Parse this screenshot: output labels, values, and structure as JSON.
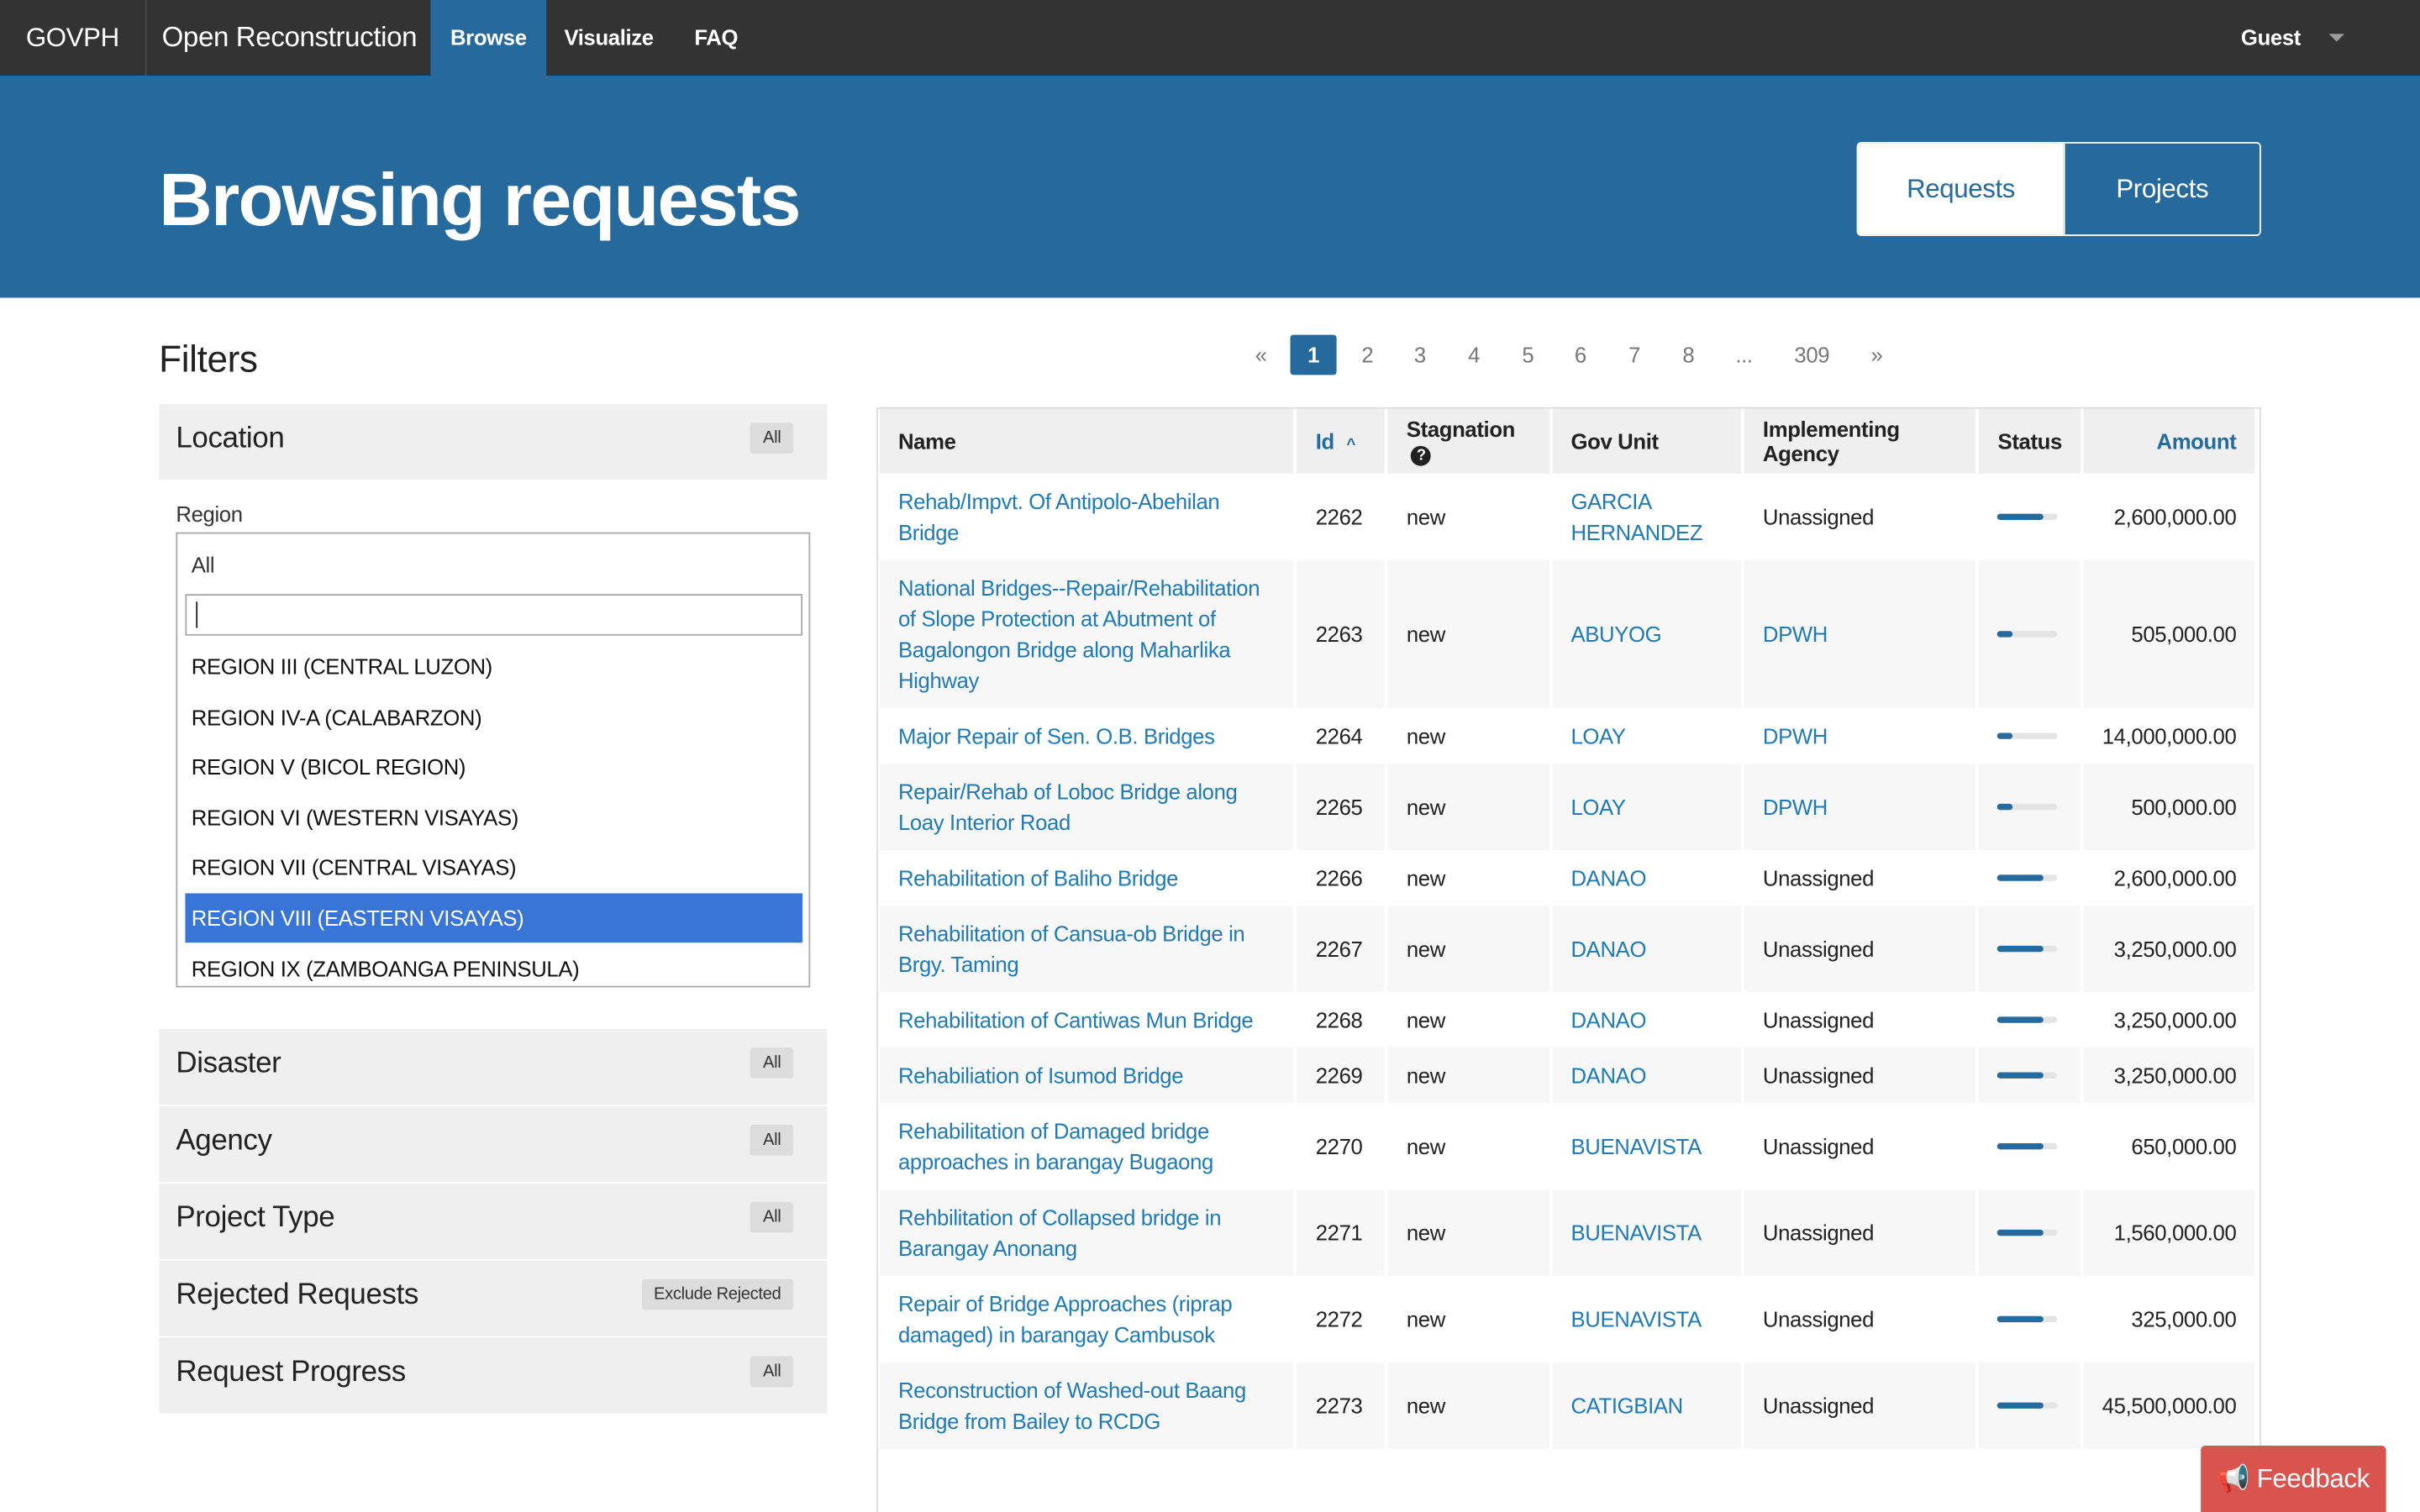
{
  "nav": {
    "brand": "GOVPH",
    "app_name": "Open Reconstruction",
    "links": [
      {
        "label": "Browse"
      },
      {
        "label": "Visualize"
      },
      {
        "label": "FAQ"
      }
    ],
    "user": "Guest"
  },
  "hero": {
    "title": "Browsing requests",
    "toggle": {
      "requests": "Requests",
      "projects": "Projects"
    }
  },
  "filters": {
    "title": "Filters",
    "location": {
      "label": "Location",
      "badge": "All"
    },
    "region": {
      "label": "Region",
      "selected": "All",
      "search_value": "",
      "options": [
        "REGION III (CENTRAL LUZON)",
        "REGION IV-A (CALABARZON)",
        "REGION V (BICOL REGION)",
        "REGION VI (WESTERN VISAYAS)",
        "REGION VII (CENTRAL VISAYAS)",
        "REGION VIII (EASTERN VISAYAS)",
        "REGION IX (ZAMBOANGA PENINSULA)"
      ],
      "highlighted": "REGION VIII (EASTERN VISAYAS)"
    },
    "panels": [
      {
        "label": "Disaster",
        "badge": "All"
      },
      {
        "label": "Agency",
        "badge": "All"
      },
      {
        "label": "Project Type",
        "badge": "All"
      },
      {
        "label": "Rejected Requests",
        "badge": "Exclude Rejected"
      },
      {
        "label": "Request Progress",
        "badge": "All"
      }
    ]
  },
  "pagination": {
    "prev": "«",
    "pages": [
      "1",
      "2",
      "3",
      "4",
      "5",
      "6",
      "7",
      "8",
      "...",
      "309"
    ],
    "current": "1",
    "next": "»"
  },
  "table": {
    "headers": {
      "name": "Name",
      "id": "Id",
      "stagnation": "Stagnation",
      "gov_unit": "Gov Unit",
      "agency": "Implementing Agency",
      "status": "Status",
      "amount": "Amount"
    },
    "rows": [
      {
        "name": "Rehab/Impvt. Of Antipolo-Abehilan Bridge",
        "id": "2262",
        "stagnation": "new",
        "gov_unit": "GARCIA HERNANDEZ",
        "agency": "Unassigned",
        "progress": 0.75,
        "amount": "2,600,000.00"
      },
      {
        "name": "National Bridges--Repair/Rehabilitation of Slope Protection at Abutment of Bagalongon Bridge along Maharlika Highway",
        "id": "2263",
        "stagnation": "new",
        "gov_unit": "ABUYOG",
        "agency": "DPWH",
        "progress": 0.25,
        "amount": "505,000.00"
      },
      {
        "name": "Major Repair of Sen. O.B. Bridges",
        "id": "2264",
        "stagnation": "new",
        "gov_unit": "LOAY",
        "agency": "DPWH",
        "progress": 0.25,
        "amount": "14,000,000.00"
      },
      {
        "name": "Repair/Rehab of Loboc Bridge along Loay Interior Road",
        "id": "2265",
        "stagnation": "new",
        "gov_unit": "LOAY",
        "agency": "DPWH",
        "progress": 0.25,
        "amount": "500,000.00"
      },
      {
        "name": "Rehabilitation of Baliho Bridge",
        "id": "2266",
        "stagnation": "new",
        "gov_unit": "DANAO",
        "agency": "Unassigned",
        "progress": 0.75,
        "amount": "2,600,000.00"
      },
      {
        "name": "Rehabilitation of Cansua-ob Bridge in Brgy. Taming",
        "id": "2267",
        "stagnation": "new",
        "gov_unit": "DANAO",
        "agency": "Unassigned",
        "progress": 0.75,
        "amount": "3,250,000.00"
      },
      {
        "name": "Rehabilitation of Cantiwas Mun Bridge",
        "id": "2268",
        "stagnation": "new",
        "gov_unit": "DANAO",
        "agency": "Unassigned",
        "progress": 0.75,
        "amount": "3,250,000.00"
      },
      {
        "name": "Rehabiliation of Isumod Bridge",
        "id": "2269",
        "stagnation": "new",
        "gov_unit": "DANAO",
        "agency": "Unassigned",
        "progress": 0.75,
        "amount": "3,250,000.00"
      },
      {
        "name": "Rehabilitation of Damaged bridge approaches in barangay Bugaong",
        "id": "2270",
        "stagnation": "new",
        "gov_unit": "BUENAVISTA",
        "agency": "Unassigned",
        "progress": 0.75,
        "amount": "650,000.00"
      },
      {
        "name": "Rehbilitation of Collapsed bridge in Barangay Anonang",
        "id": "2271",
        "stagnation": "new",
        "gov_unit": "BUENAVISTA",
        "agency": "Unassigned",
        "progress": 0.75,
        "amount": "1,560,000.00"
      },
      {
        "name": "Repair of Bridge Approaches (riprap damaged) in barangay Cambusok",
        "id": "2272",
        "stagnation": "new",
        "gov_unit": "BUENAVISTA",
        "agency": "Unassigned",
        "progress": 0.75,
        "amount": "325,000.00"
      },
      {
        "name": "Reconstruction of Washed-out Baang Bridge from Bailey to RCDG",
        "id": "2273",
        "stagnation": "new",
        "gov_unit": "CATIGBIAN",
        "agency": "Unassigned",
        "progress": 0.75,
        "amount": "45,500,000.00"
      }
    ]
  },
  "feedback": {
    "label": "Feedback"
  },
  "colors": {
    "nav_bg": "#333333",
    "brand_blue": "#26699c",
    "link_blue": "#1f7ab5",
    "highlight": "#3875d7",
    "feedback": "#d9534f"
  }
}
